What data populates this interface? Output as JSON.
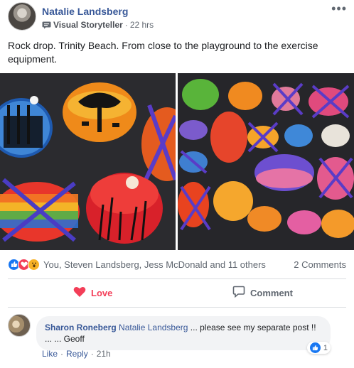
{
  "post": {
    "author": "Natalie Landsberg",
    "badge": "Visual Storyteller",
    "separator": "·",
    "time": "22 hrs",
    "more": "•••",
    "text": "Rock drop. Trinity Beach. From close to the playground to the exercise equipment."
  },
  "reactions": {
    "names": "You, Steven Landsberg, Jess McDonald and 11 others",
    "comments_count": "2 Comments"
  },
  "actions": {
    "love_label": "Love",
    "comment_label": "Comment"
  },
  "comment": {
    "author": "Sharon Roneberg",
    "mention": "Natalie Landsberg",
    "text": "... please see my separate post !! ... ... Geoff",
    "like_label": "Like",
    "reply_label": "Reply",
    "dot": "·",
    "time": "21h",
    "like_count": "1"
  },
  "colors": {
    "link_blue": "#385898",
    "love_red": "#f33e58",
    "like_blue": "#1877f2",
    "wow_yellow": "#f7b125"
  }
}
